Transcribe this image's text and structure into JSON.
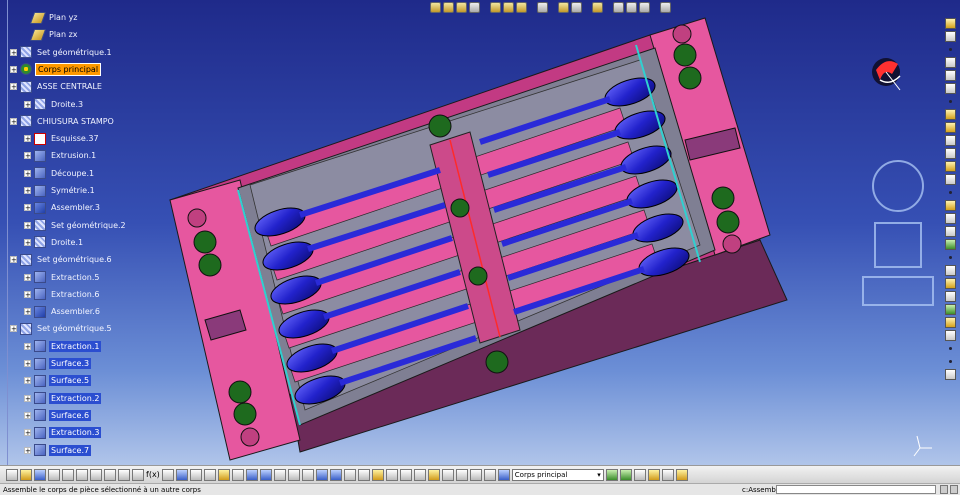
{
  "tree": {
    "nodes": [
      {
        "label": "Plan yz",
        "icon": "plane-icon",
        "state": "normal"
      },
      {
        "label": "Plan zx",
        "icon": "plane-icon",
        "state": "normal"
      },
      {
        "label": "Set géométrique.1",
        "icon": "geometrical-set-icon",
        "state": "normal"
      },
      {
        "label": "Corps principal",
        "icon": "part-body-icon",
        "state": "highlighted"
      },
      {
        "label": "ASSE CENTRALE",
        "icon": "geometrical-set-icon",
        "state": "normal"
      },
      {
        "label": "Droite.3",
        "icon": "line-icon",
        "state": "normal"
      },
      {
        "label": "CHIUSURA STAMPO",
        "icon": "geometrical-set-icon",
        "state": "normal"
      },
      {
        "label": "Esquisse.37",
        "icon": "sketch-icon",
        "state": "normal"
      },
      {
        "label": "Extrusion.1",
        "icon": "surface-icon",
        "state": "normal"
      },
      {
        "label": "Découpe.1",
        "icon": "surface-icon",
        "state": "normal"
      },
      {
        "label": "Symétrie.1",
        "icon": "surface-icon",
        "state": "normal"
      },
      {
        "label": "Assembler.3",
        "icon": "join-icon",
        "state": "normal"
      },
      {
        "label": "Set géométrique.2",
        "icon": "geometrical-set-icon",
        "state": "normal"
      },
      {
        "label": "Droite.1",
        "icon": "line-icon",
        "state": "normal"
      },
      {
        "label": "Set géométrique.6",
        "icon": "geometrical-set-icon",
        "state": "normal"
      },
      {
        "label": "Extraction.5",
        "icon": "surface-icon",
        "state": "normal"
      },
      {
        "label": "Extraction.6",
        "icon": "surface-icon",
        "state": "normal"
      },
      {
        "label": "Assembler.6",
        "icon": "join-icon",
        "state": "normal"
      },
      {
        "label": "Set géométrique.5",
        "icon": "geometrical-set-icon",
        "state": "normal"
      },
      {
        "label": "Extraction.1",
        "icon": "surface-icon",
        "state": "selected"
      },
      {
        "label": "Surface.3",
        "icon": "surface-icon",
        "state": "selected"
      },
      {
        "label": "Surface.5",
        "icon": "surface-icon",
        "state": "selected"
      },
      {
        "label": "Extraction.2",
        "icon": "surface-icon",
        "state": "selected"
      },
      {
        "label": "Surface.6",
        "icon": "surface-icon",
        "state": "selected"
      },
      {
        "label": "Extraction.3",
        "icon": "surface-icon",
        "state": "selected"
      },
      {
        "label": "Surface.7",
        "icon": "surface-icon",
        "state": "selected"
      }
    ]
  },
  "bottom_toolbar": {
    "current_body_combo": "Corps principal"
  },
  "status_bar": {
    "message": "Assemble le corps de pièce sélectionné à un autre corps",
    "command_label": "c:Assembler",
    "command_value": ""
  },
  "colors": {
    "viewport_top": "#1f2a8a",
    "viewport_bottom": "#c6d6f0",
    "mold_pink": "#e6579f",
    "mold_magenta": "#c23a83",
    "mold_side": "#6b2a58",
    "insert_gray": "#7f7f93",
    "spoon_blue": "#2222cc",
    "pin_green": "#1e6a1e",
    "highlight_orange": "#ff9900",
    "selection_blue": "#2b4ed0"
  },
  "viewport": {
    "model": "spoon-mold-cavity-plate",
    "view_widgets": [
      "rotate-view-icon",
      "pan-view-icon",
      "zoom-view-icon"
    ],
    "compass": "compass-icon",
    "axis_triad": "axis-triad-icon"
  }
}
